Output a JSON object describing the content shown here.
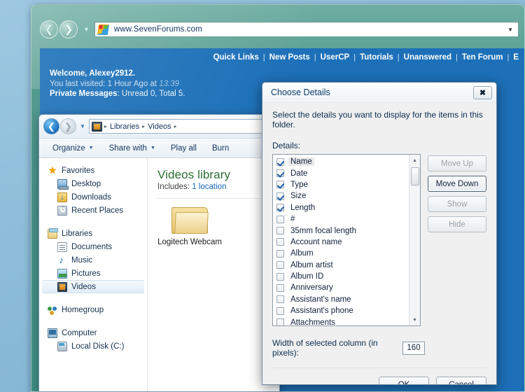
{
  "browser": {
    "back_icon": "back-arrow-icon",
    "forward_icon": "forward-arrow-icon",
    "history_caret": "▼",
    "url": "www.SevenForums.com",
    "address_dropdown_caret": "▼"
  },
  "forum": {
    "nav_links": [
      "Quick Links",
      "New Posts",
      "UserCP",
      "Tutorials",
      "Unanswered",
      "Ten Forum",
      "E"
    ],
    "separator": "|",
    "welcome_prefix": "Welcome, ",
    "welcome_user": "Alexey2912.",
    "last_visited_prefix": "You last visited: 1 Hour Ago at ",
    "last_visited_time": "13:39",
    "private_messages_label": "Private Messages",
    "private_messages_value": ": Unread 0, Total 5."
  },
  "explorer": {
    "back_icon": "back-arrow-icon",
    "forward_icon": "forward-arrow-icon",
    "history_caret": "▼",
    "breadcrumb": [
      "Libraries",
      "Videos"
    ],
    "breadcrumb_arrow": "▸",
    "toolbar": [
      {
        "label": "Organize",
        "caret": "▼"
      },
      {
        "label": "Share with",
        "caret": "▼"
      },
      {
        "label": "Play all",
        "caret": ""
      },
      {
        "label": "Burn",
        "caret": ""
      }
    ],
    "sidebar": {
      "favorites": {
        "header": "Favorites",
        "items": [
          "Desktop",
          "Downloads",
          "Recent Places"
        ]
      },
      "libraries": {
        "header": "Libraries",
        "items": [
          "Documents",
          "Music",
          "Pictures",
          "Videos"
        ],
        "selected": "Videos"
      },
      "homegroup": "Homegroup",
      "computer": {
        "header": "Computer",
        "items": [
          "Local Disk (C:)"
        ]
      }
    },
    "content": {
      "library_title": "Videos library",
      "includes_label": "Includes: ",
      "includes_link": "1 location",
      "file_name": "Logitech Webcam"
    }
  },
  "dialog": {
    "title": "Choose Details",
    "close_glyph": "✖",
    "instruction": "Select the details you want to display for the items in this folder.",
    "details_label": "Details:",
    "details": [
      {
        "label": "Name",
        "checked": true,
        "selected": true
      },
      {
        "label": "Date",
        "checked": true,
        "selected": false
      },
      {
        "label": "Type",
        "checked": true,
        "selected": false
      },
      {
        "label": "Size",
        "checked": true,
        "selected": false
      },
      {
        "label": "Length",
        "checked": true,
        "selected": false
      },
      {
        "label": "#",
        "checked": false,
        "selected": false
      },
      {
        "label": "35mm focal length",
        "checked": false,
        "selected": false
      },
      {
        "label": "Account name",
        "checked": false,
        "selected": false
      },
      {
        "label": "Album",
        "checked": false,
        "selected": false
      },
      {
        "label": "Album artist",
        "checked": false,
        "selected": false
      },
      {
        "label": "Album ID",
        "checked": false,
        "selected": false
      },
      {
        "label": "Anniversary",
        "checked": false,
        "selected": false
      },
      {
        "label": "Assistant's name",
        "checked": false,
        "selected": false
      },
      {
        "label": "Assistant's phone",
        "checked": false,
        "selected": false
      },
      {
        "label": "Attachments",
        "checked": false,
        "selected": false
      }
    ],
    "scroll_up_glyph": "▲",
    "scroll_down_glyph": "▼",
    "side_buttons": [
      {
        "label": "Move Up",
        "enabled": false
      },
      {
        "label": "Move Down",
        "enabled": true
      },
      {
        "label": "Show",
        "enabled": false
      },
      {
        "label": "Hide",
        "enabled": false
      }
    ],
    "width_label": "Width of selected column (in pixels):",
    "width_value": "160",
    "ok_label": "OK",
    "cancel_label": "Cancel"
  }
}
